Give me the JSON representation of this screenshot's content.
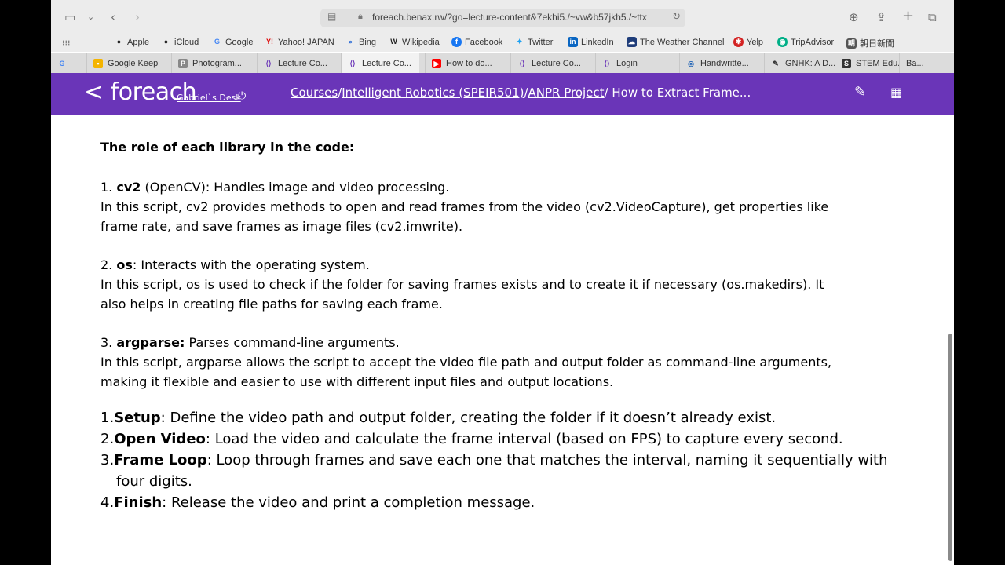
{
  "browser": {
    "url": "foreach.benax.rw/?go=lecture-content&7ekhi5./~vw&b57jkh5./~ttx"
  },
  "bookmarks": [
    {
      "label": "Apple",
      "icon": "apple-icon"
    },
    {
      "label": "iCloud",
      "icon": "apple-icon"
    },
    {
      "label": "Google",
      "icon": "google-icon"
    },
    {
      "label": "Yahoo! JAPAN",
      "icon": "yahoo-icon"
    },
    {
      "label": "Bing",
      "icon": "search-icon"
    },
    {
      "label": "Wikipedia",
      "icon": "wikipedia-icon"
    },
    {
      "label": "Facebook",
      "icon": "facebook-icon"
    },
    {
      "label": "Twitter",
      "icon": "twitter-icon"
    },
    {
      "label": "LinkedIn",
      "icon": "linkedin-icon"
    },
    {
      "label": "The Weather Channel",
      "icon": "weather-icon"
    },
    {
      "label": "Yelp",
      "icon": "yelp-icon"
    },
    {
      "label": "TripAdvisor",
      "icon": "tripadvisor-icon"
    },
    {
      "label": "朝日新聞",
      "icon": "asahi-icon"
    }
  ],
  "tabs": [
    {
      "label": "Google Keep"
    },
    {
      "label": "Photogram..."
    },
    {
      "label": "Lecture Co..."
    },
    {
      "label": "Lecture Co..."
    },
    {
      "label": "How to do..."
    },
    {
      "label": "Lecture Co..."
    },
    {
      "label": "Login"
    },
    {
      "label": "Handwritte..."
    },
    {
      "label": "GNHK: A D..."
    },
    {
      "label": "STEM Edu..."
    },
    {
      "label": "Ba..."
    }
  ],
  "header": {
    "logo": "< foreach",
    "desk": "Gabriel`s Desk",
    "breadcrumb": {
      "courses": "Courses",
      "course": "Intelligent Robotics (SPEIR501)",
      "project": "ANPR Project",
      "current": "/ How to Extract Frame..."
    }
  },
  "content": {
    "heading": "The role of each library in the code:",
    "lib1_num": "1. ",
    "lib1_name": "cv2",
    "lib1_desc": " (OpenCV): Handles image and video processing.",
    "lib1_line2": "In this script, cv2 provides methods to open and read frames from the video (cv2.VideoCapture), get properties like",
    "lib1_line3": "frame rate, and save frames as image files (cv2.imwrite).",
    "lib2_num": "2. ",
    "lib2_name": "os",
    "lib2_desc": ": Interacts with the operating system.",
    "lib2_line2": "In this script, os is used to check if the folder for saving frames exists and to create it if necessary (os.makedirs). It",
    "lib2_line3": "also helps in creating file paths for saving each frame.",
    "lib3_num": "3. ",
    "lib3_name": "argparse:",
    "lib3_desc": " Parses command-line arguments.",
    "lib3_line2": "In this script, argparse allows the script to accept the video file path and output folder as command-line arguments,",
    "lib3_line3": "making it flexible and easier to use with different input files and output locations.",
    "steps": [
      {
        "num": "1.",
        "title": "Setup",
        "text": ": Define the video path and output folder, creating the folder if it doesn’t already exist."
      },
      {
        "num": "2.",
        "title": "Open Video",
        "text": ": Load the video and calculate the frame interval (based on FPS) to capture every second."
      },
      {
        "num": "3.",
        "title": "Frame Loop",
        "text": ": Loop through frames and save each one that matches the interval, naming it sequentially with"
      },
      {
        "num": "",
        "title": "",
        "text": "four digits."
      },
      {
        "num": "4.",
        "title": "Finish",
        "text": ": Release the video and print a completion message."
      }
    ]
  }
}
